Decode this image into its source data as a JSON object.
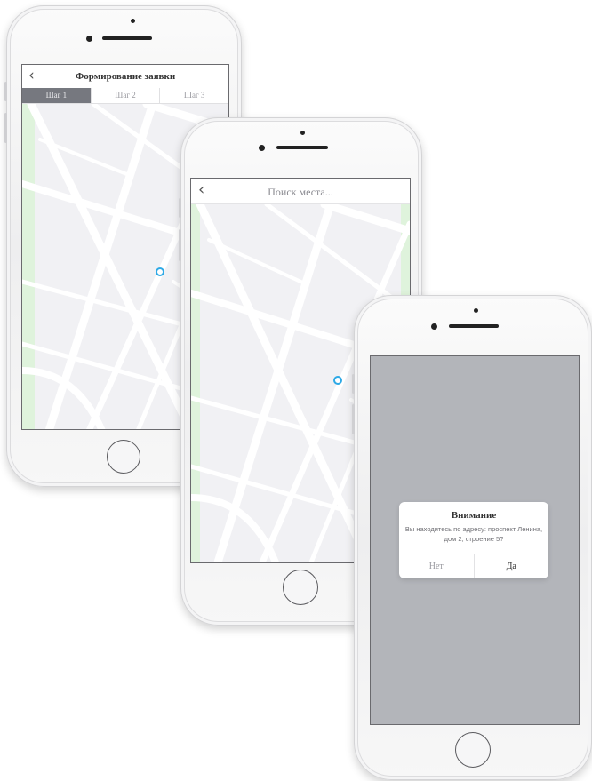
{
  "screen1": {
    "title": "Формирование заявки",
    "tabs": [
      {
        "label": "Шаг 1",
        "active": true
      },
      {
        "label": "Шаг 2",
        "active": false
      },
      {
        "label": "Шаг 3",
        "active": false
      }
    ]
  },
  "screen2": {
    "search": {
      "placeholder": "Поиск места..."
    }
  },
  "screen3": {
    "dialog": {
      "title": "Внимание",
      "message": "Вы находитесь по адресу: проспект Ленина, дом 2, строение 5?",
      "no_label": "Нет",
      "yes_label": "Да"
    }
  },
  "colors": {
    "accent": "#2ea9e6",
    "active_tab": "#76787f",
    "overlay": "#b3b5ba",
    "map_bg": "#f1f1f4"
  }
}
